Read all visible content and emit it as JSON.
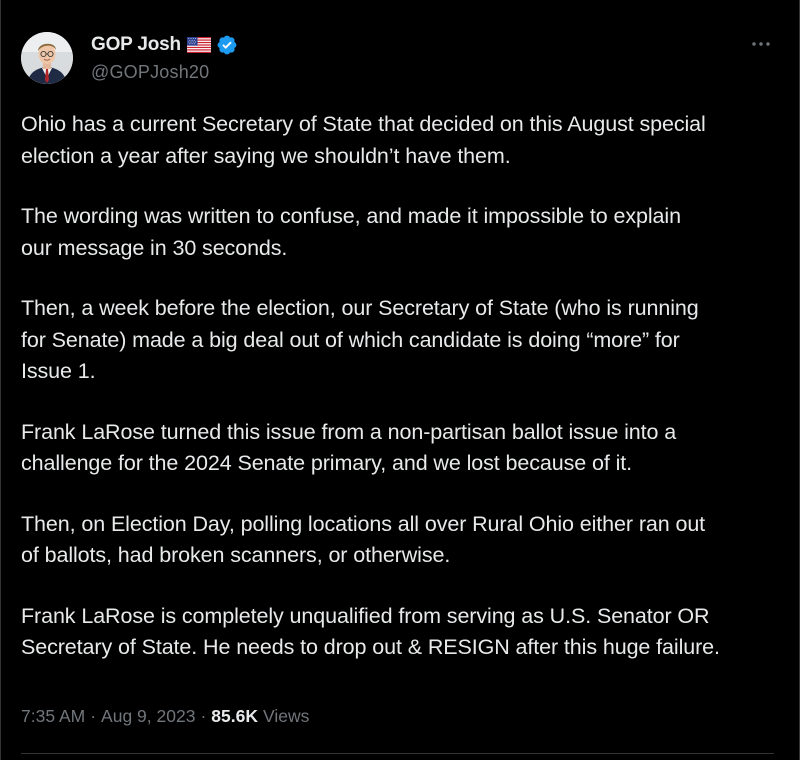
{
  "author": {
    "display_name": "GOP Josh",
    "handle": "@GOPJosh20",
    "flag_icon": "us-flag-icon",
    "verified_icon": "verified-badge-icon"
  },
  "tweet": {
    "paragraphs": [
      "Ohio has a current Secretary of State that decided on this August special\nelection a year after saying we shouldn’t have them.",
      "The wording was written to confuse, and made it impossible to explain\nour message in 30 seconds.",
      "Then, a week before the election, our Secretary of State (who is running\nfor Senate) made a big deal out of which candidate is doing “more” for\nIssue 1.",
      "Frank LaRose turned this issue from a non-partisan ballot issue into a\nchallenge for the 2024 Senate primary, and we lost because of it.",
      "Then, on Election Day, polling locations all over Rural Ohio either ran out\nof ballots, had broken scanners, or otherwise.",
      "Frank LaRose is completely unqualified from serving as U.S. Senator OR\nSecretary of State. He needs to drop out & RESIGN after this huge failure."
    ],
    "time": "7:35 AM",
    "date": "Aug 9, 2023",
    "views_count": "85.6K",
    "views_label": "Views",
    "separator": "·"
  },
  "colors": {
    "background": "#000000",
    "text_primary": "#e7e9ea",
    "text_secondary": "#71767b",
    "verified_blue": "#1d9bf0",
    "divider": "#2f3336"
  },
  "icons": {
    "more": "more-horizontal-icon"
  }
}
